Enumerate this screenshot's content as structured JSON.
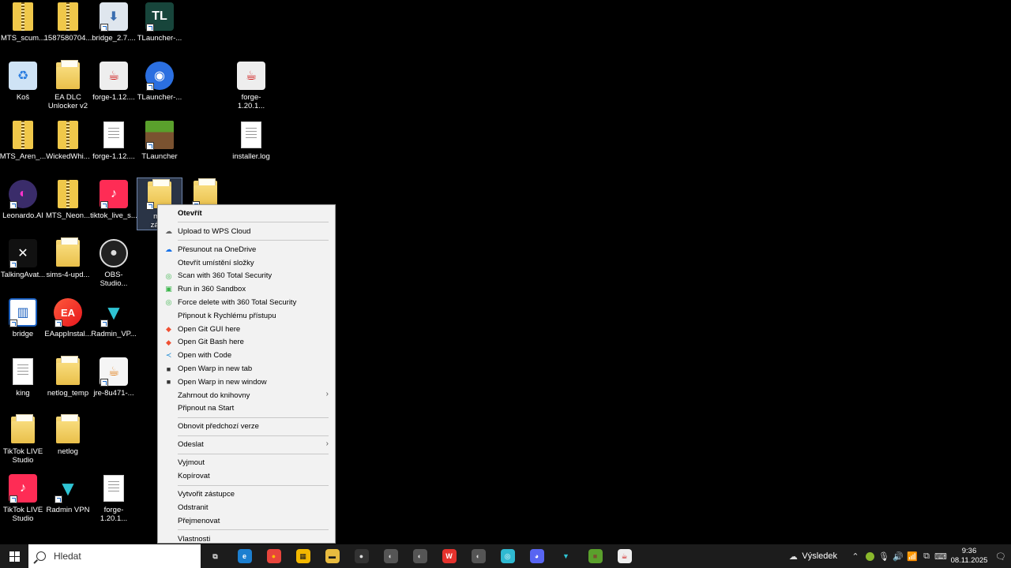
{
  "desktop": {
    "icons": [
      {
        "label": "MTS_scum...",
        "icon": "zip-icon"
      },
      {
        "label": "1587580704...",
        "icon": "zip-icon"
      },
      {
        "label": "bridge_2.7....",
        "icon": "installer-icon"
      },
      {
        "label": "TLauncher-...",
        "icon": "tlauncher-icon"
      },
      {
        "label": "Koš",
        "icon": "recycle-bin-icon"
      },
      {
        "label": "EA DLC\nUnlocker v2",
        "icon": "folder-icon"
      },
      {
        "label": "forge-1.12....",
        "icon": "java-icon"
      },
      {
        "label": "TLauncher-...",
        "icon": "tlauncher-blue-icon"
      },
      {
        "label": "forge-1.20.1...",
        "icon": "java-icon"
      },
      {
        "label": "MTS_Aren_...",
        "icon": "zip-icon"
      },
      {
        "label": "WickedWhi...",
        "icon": "zip-icon"
      },
      {
        "label": "forge-1.12....",
        "icon": "document-icon"
      },
      {
        "label": "TLauncher",
        "icon": "minecraft-icon"
      },
      {
        "label": "installer.log",
        "icon": "document-icon"
      },
      {
        "label": "Leonardo.AI",
        "icon": "leonardo-icon"
      },
      {
        "label": "MTS_Neon...",
        "icon": "zip-icon"
      },
      {
        "label": "tiktok_live_s...",
        "icon": "tiktok-icon"
      },
      {
        "label": "m...\nzás...",
        "icon": "folder-icon"
      },
      {
        "label": "",
        "icon": "folder-icon"
      },
      {
        "label": "TalkingAvat...",
        "icon": "talkingavatar-icon"
      },
      {
        "label": "sims-4-upd...",
        "icon": "folder-icon"
      },
      {
        "label": "OBS-Studio...",
        "icon": "obs-icon"
      },
      {
        "label": "bridge",
        "icon": "bridge-icon"
      },
      {
        "label": "EAappInstal...",
        "icon": "ea-icon"
      },
      {
        "label": "Radmin_VP...",
        "icon": "radmin-icon"
      },
      {
        "label": "king",
        "icon": "document-icon"
      },
      {
        "label": "netlog_temp",
        "icon": "folder-icon"
      },
      {
        "label": "jre-8u471-...",
        "icon": "java-installer-icon"
      },
      {
        "label": "TikTok LIVE\nStudio",
        "icon": "folder-icon"
      },
      {
        "label": "netlog",
        "icon": "folder-icon"
      },
      {
        "label": "TikTok LIVE\nStudio",
        "icon": "tiktok-icon"
      },
      {
        "label": "Radmin VPN",
        "icon": "radmin-icon"
      },
      {
        "label": "forge-1.20.1...",
        "icon": "document-icon"
      }
    ]
  },
  "context_menu": {
    "items": [
      {
        "label": "Otevřít",
        "bold": true
      },
      {
        "sep": true
      },
      {
        "label": "Upload to WPS Cloud",
        "icon": "cloud-icon"
      },
      {
        "sep": true
      },
      {
        "label": "Přesunout na OneDrive",
        "icon": "onedrive-icon"
      },
      {
        "label": "Otevřít umístění složky"
      },
      {
        "label": "Scan with 360 Total Security",
        "icon": "360-icon"
      },
      {
        "label": "Run in 360 Sandbox",
        "icon": "sandbox-icon"
      },
      {
        "label": "Force delete with 360 Total Security",
        "icon": "360-icon"
      },
      {
        "label": "Připnout k Rychlému přístupu"
      },
      {
        "label": "Open Git GUI here",
        "icon": "git-icon"
      },
      {
        "label": "Open Git Bash here",
        "icon": "git-icon"
      },
      {
        "label": "Open with Code",
        "icon": "vscode-icon"
      },
      {
        "label": "Open Warp in new tab",
        "icon": "warp-icon"
      },
      {
        "label": "Open Warp in new window",
        "icon": "warp-icon"
      },
      {
        "label": "Zahrnout do knihovny",
        "submenu": true
      },
      {
        "label": "Připnout na Start"
      },
      {
        "sep": true
      },
      {
        "label": "Obnovit předchozí verze"
      },
      {
        "sep": true
      },
      {
        "label": "Odeslat",
        "submenu": true
      },
      {
        "sep": true
      },
      {
        "label": "Vyjmout"
      },
      {
        "label": "Kopírovat"
      },
      {
        "sep": true
      },
      {
        "label": "Vytvořit zástupce"
      },
      {
        "label": "Odstranit"
      },
      {
        "label": "Přejmenovat"
      },
      {
        "sep": true
      },
      {
        "label": "Vlastnosti"
      }
    ]
  },
  "taskbar": {
    "search_placeholder": "Hledat",
    "apps": [
      "task-view-icon",
      "edge-icon",
      "chrome-icon",
      "store-icon",
      "explorer-icon",
      "obs-icon",
      "app-icon",
      "app-icon",
      "wps-icon",
      "app-icon",
      "360-icon",
      "discord-icon",
      "radmin-icon",
      "minecraft-icon",
      "java-icon"
    ],
    "weather_label": "Výsledek",
    "time": "9:36",
    "date": "08.11.2025"
  }
}
